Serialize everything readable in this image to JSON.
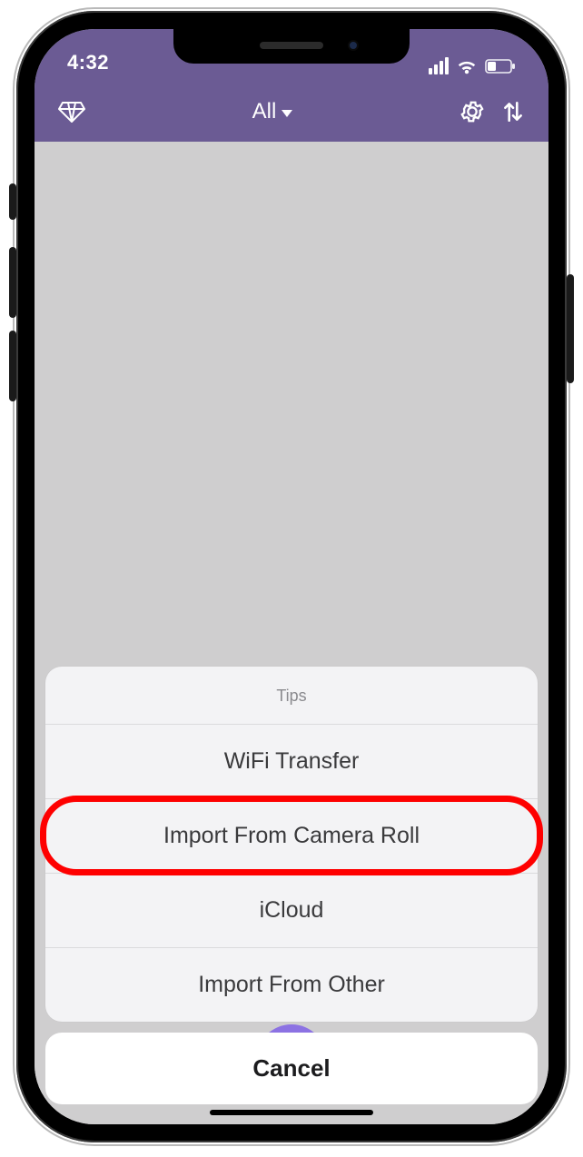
{
  "status": {
    "time": "4:32"
  },
  "navbar": {
    "title": "All"
  },
  "sheet": {
    "header": "Tips",
    "options": [
      "WiFi Transfer",
      "Import From Camera Roll",
      "iCloud",
      "Import From Other"
    ],
    "cancel": "Cancel"
  },
  "highlight_option_index": 1
}
